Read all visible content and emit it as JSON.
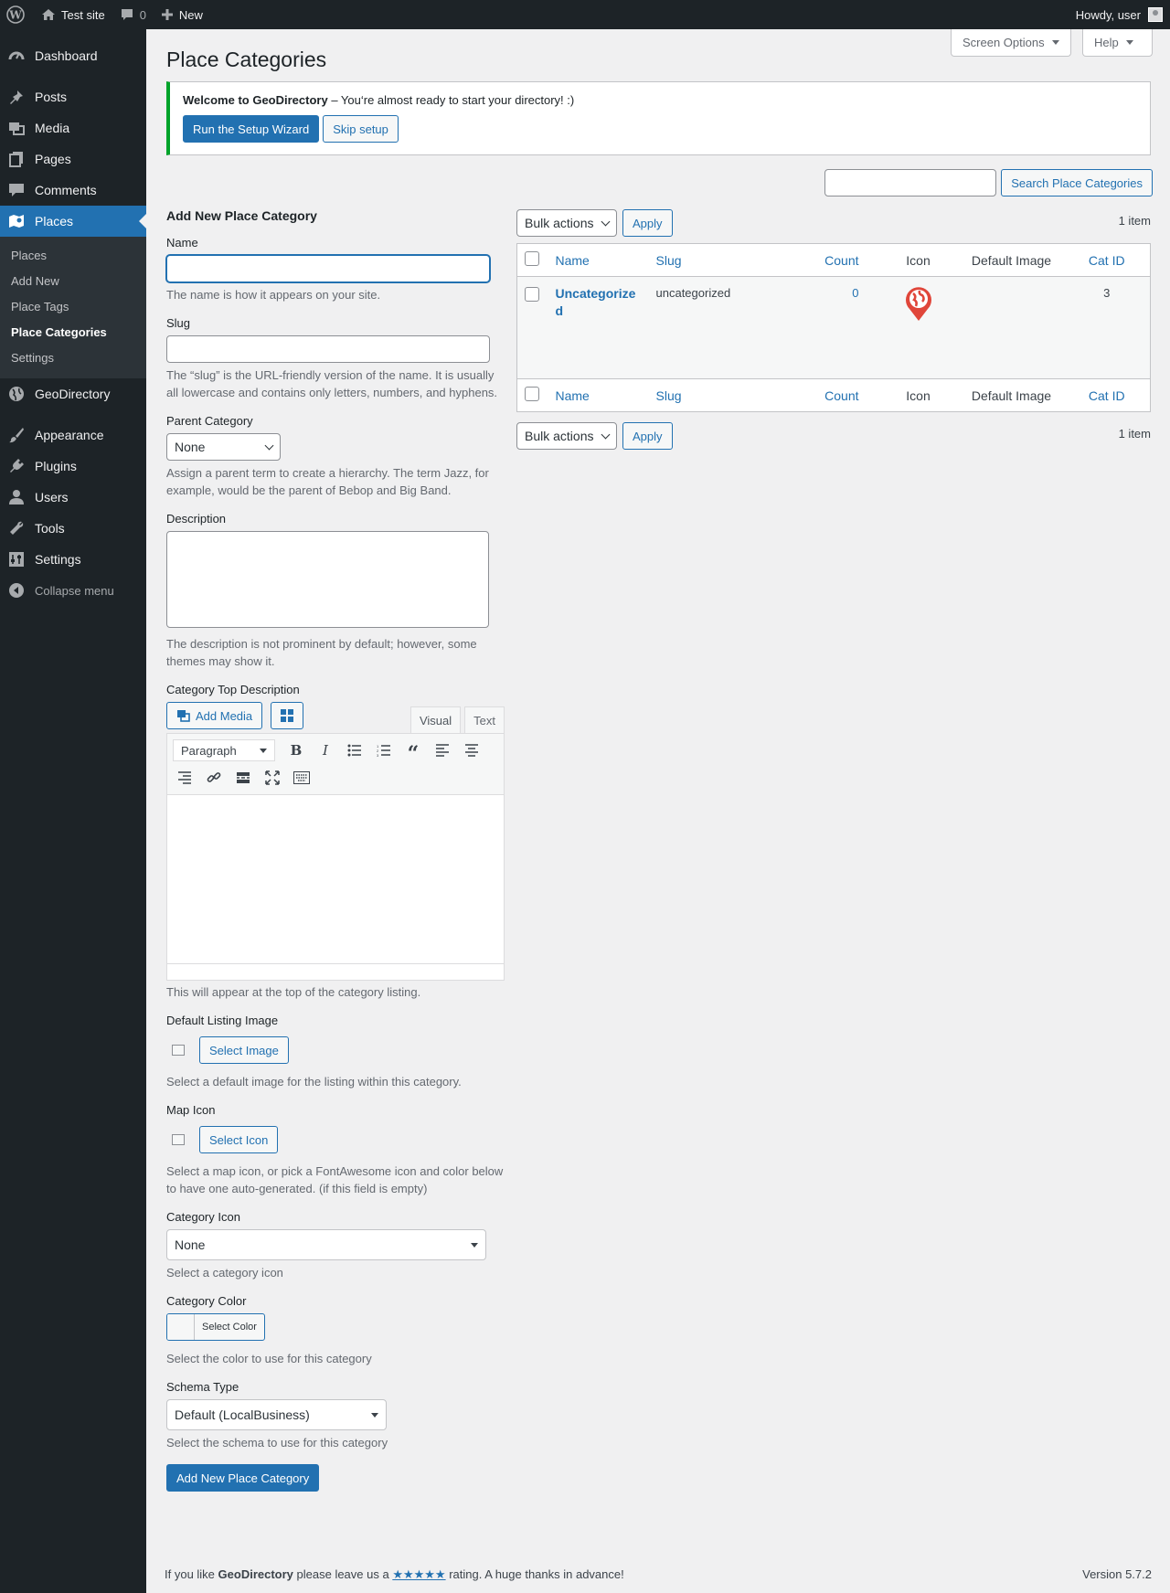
{
  "adminbar": {
    "site_name": "Test site",
    "comments_count": "0",
    "new_label": "New",
    "howdy": "Howdy, user"
  },
  "sidebar": {
    "items": [
      {
        "label": "Dashboard",
        "icon": "dashboard-icon"
      },
      {
        "label": "Posts",
        "icon": "pin-icon"
      },
      {
        "label": "Media",
        "icon": "media-icon"
      },
      {
        "label": "Pages",
        "icon": "pages-icon"
      },
      {
        "label": "Comments",
        "icon": "comment-icon"
      },
      {
        "label": "Places",
        "icon": "map-icon"
      },
      {
        "label": "GeoDirectory",
        "icon": "globe-icon"
      },
      {
        "label": "Appearance",
        "icon": "brush-icon"
      },
      {
        "label": "Plugins",
        "icon": "plug-icon"
      },
      {
        "label": "Users",
        "icon": "user-icon"
      },
      {
        "label": "Tools",
        "icon": "wrench-icon"
      },
      {
        "label": "Settings",
        "icon": "settings-icon"
      }
    ],
    "submenu": [
      "Places",
      "Add New",
      "Place Tags",
      "Place Categories",
      "Settings"
    ],
    "collapse": "Collapse menu"
  },
  "header": {
    "title": "Place Categories",
    "screen_options": "Screen Options",
    "help": "Help"
  },
  "notice": {
    "bold": "Welcome to GeoDirectory",
    "text": " – You‘re almost ready to start your directory! :)",
    "wizard_button": "Run the Setup Wizard",
    "skip_button": "Skip setup"
  },
  "search": {
    "button": "Search Place Categories"
  },
  "form": {
    "heading": "Add New Place Category",
    "name_label": "Name",
    "name_desc": "The name is how it appears on your site.",
    "slug_label": "Slug",
    "slug_desc": "The “slug” is the URL-friendly version of the name. It is usually all lowercase and contains only letters, numbers, and hyphens.",
    "parent_label": "Parent Category",
    "parent_value": "None",
    "parent_desc": "Assign a parent term to create a hierarchy. The term Jazz, for example, would be the parent of Bebop and Big Band.",
    "description_label": "Description",
    "description_desc": "The description is not prominent by default; however, some themes may show it.",
    "top_desc_label": "Category Top Description",
    "add_media": "Add Media",
    "tab_visual": "Visual",
    "tab_text": "Text",
    "paragraph": "Paragraph",
    "top_desc_help": "This will appear at the top of the category listing.",
    "default_image_label": "Default Listing Image",
    "select_image": "Select Image",
    "default_image_desc": "Select a default image for the listing within this category.",
    "map_icon_label": "Map Icon",
    "select_icon": "Select Icon",
    "map_icon_desc": "Select a map icon, or pick a FontAwesome icon and color below to have one auto-generated. (if this field is empty)",
    "cat_icon_label": "Category Icon",
    "cat_icon_value": "None",
    "cat_icon_desc": "Select a category icon",
    "cat_color_label": "Category Color",
    "select_color": "Select Color",
    "cat_color_desc": "Select the color to use for this category",
    "schema_label": "Schema Type",
    "schema_value": "Default (LocalBusiness)",
    "schema_desc": "Select the schema to use for this category",
    "submit": "Add New Place Category"
  },
  "table": {
    "bulk_actions": "Bulk actions",
    "apply": "Apply",
    "items_count": "1 item",
    "columns": [
      "Name",
      "Slug",
      "Count",
      "Icon",
      "Default Image",
      "Cat ID"
    ],
    "rows": [
      {
        "name": "Uncategorized",
        "slug": "uncategorized",
        "count": "0",
        "icon": "map-pin-globe-icon",
        "default_image": "",
        "cat_id": "3"
      }
    ]
  },
  "footer": {
    "left_pre": "If you like ",
    "brand": "GeoDirectory",
    "left_mid": " please leave us a ",
    "stars": "★★★★★",
    "left_post": " rating. A huge thanks in advance!",
    "version": "Version 5.7.2"
  },
  "colors": {
    "accent": "#2271b1",
    "sidebar_bg": "#1d2327",
    "notice_border": "#00a32a",
    "pin_red": "#e0463a"
  }
}
